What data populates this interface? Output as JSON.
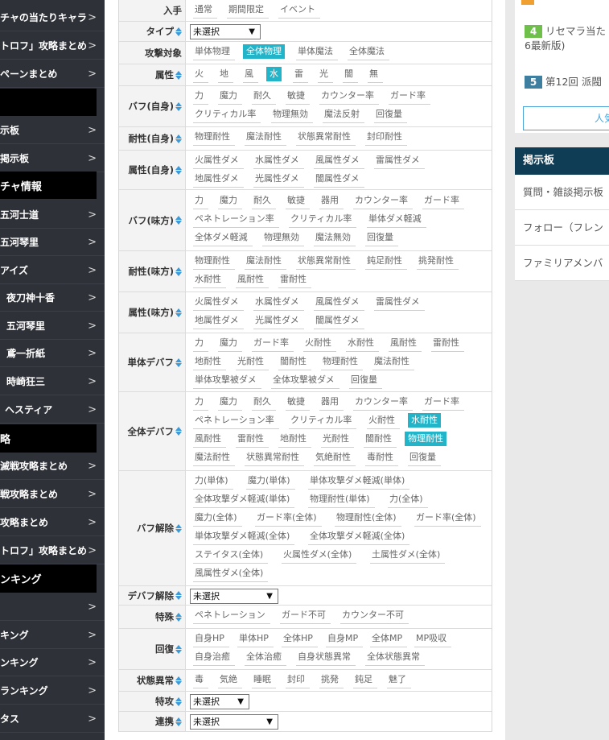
{
  "sidebar": {
    "items": [
      {
        "label": "チャの当たりキャラ",
        "type": "item"
      },
      {
        "label": "トロフ」攻略まとめ",
        "type": "item"
      },
      {
        "label": "ペーンまとめ",
        "type": "item"
      },
      {
        "label": "",
        "type": "head"
      },
      {
        "label": "示板",
        "type": "item"
      },
      {
        "label": "掲示板",
        "type": "item"
      },
      {
        "label": "チャ情報",
        "type": "head"
      },
      {
        "label": "五河士道",
        "type": "item"
      },
      {
        "label": "五河琴里",
        "type": "item"
      },
      {
        "label": "アイズ",
        "type": "item"
      },
      {
        "label": "夜刀神十香",
        "type": "item"
      },
      {
        "label": "五河琴里",
        "type": "item"
      },
      {
        "label": "鳶一折紙",
        "type": "item"
      },
      {
        "label": "時崎狂三",
        "type": "item"
      },
      {
        "label": "ヘスティア",
        "type": "item"
      },
      {
        "label": "略",
        "type": "head"
      },
      {
        "label": "滅戦攻略まとめ",
        "type": "item"
      },
      {
        "label": "戦攻略まとめ",
        "type": "item"
      },
      {
        "label": "攻略まとめ",
        "type": "item"
      },
      {
        "label": "トロフ」攻略まとめ",
        "type": "item"
      },
      {
        "label": "ンキング",
        "type": "head"
      },
      {
        "label": "",
        "type": "item"
      },
      {
        "label": "キング",
        "type": "item"
      },
      {
        "label": "ンキング",
        "type": "item"
      },
      {
        "label": "ランキング",
        "type": "item"
      },
      {
        "label": "タス",
        "type": "item"
      }
    ]
  },
  "filters": [
    {
      "label": "入手",
      "sort": false,
      "options": [
        [
          "通常",
          "期間限定",
          "イベント"
        ]
      ]
    },
    {
      "label": "タイプ",
      "sort": true,
      "select": "未選択"
    },
    {
      "label": "攻撃対象",
      "sort": false,
      "options": [
        [
          "単体物理",
          "全体物理",
          "単体魔法",
          "全体魔法"
        ]
      ],
      "selected": [
        "全体物理"
      ]
    },
    {
      "label": "属性",
      "sort": true,
      "options": [
        [
          "火",
          "地",
          "風",
          "水",
          "雷",
          "光",
          "闇",
          "無"
        ]
      ],
      "selected": [
        "水"
      ]
    },
    {
      "label": "バフ(自身)",
      "sort": true,
      "options": [
        [
          "力",
          "魔力",
          "耐久",
          "敏捷",
          "カウンター率",
          "ガード率"
        ],
        [
          "クリティカル率",
          "物理無効",
          "魔法反射",
          "回復量"
        ]
      ]
    },
    {
      "label": "耐性(自身)",
      "sort": true,
      "options": [
        [
          "物理耐性",
          "魔法耐性",
          "状態異常耐性",
          "封印耐性"
        ]
      ]
    },
    {
      "label": "属性(自身)",
      "sort": true,
      "options": [
        [
          "火属性ダメ",
          "水属性ダメ",
          "風属性ダメ",
          "雷属性ダメ"
        ],
        [
          "地属性ダメ",
          "光属性ダメ",
          "闇属性ダメ"
        ]
      ]
    },
    {
      "label": "バフ(味方)",
      "sort": true,
      "options": [
        [
          "力",
          "魔力",
          "耐久",
          "敏捷",
          "器用",
          "カウンター率",
          "ガード率"
        ],
        [
          "ペネトレーション率",
          "クリティカル率",
          "単体ダメ軽減"
        ],
        [
          "全体ダメ軽減",
          "物理無効",
          "魔法無効",
          "回復量"
        ]
      ]
    },
    {
      "label": "耐性(味方)",
      "sort": true,
      "options": [
        [
          "物理耐性",
          "魔法耐性",
          "状態異常耐性",
          "鈍足耐性",
          "挑発耐性"
        ],
        [
          "水耐性",
          "風耐性",
          "雷耐性"
        ]
      ]
    },
    {
      "label": "属性(味方)",
      "sort": true,
      "options": [
        [
          "火属性ダメ",
          "水属性ダメ",
          "風属性ダメ",
          "雷属性ダメ"
        ],
        [
          "地属性ダメ",
          "光属性ダメ",
          "闇属性ダメ"
        ]
      ]
    },
    {
      "label": "単体デバフ",
      "sort": true,
      "options": [
        [
          "力",
          "魔力",
          "ガード率",
          "火耐性",
          "水耐性",
          "風耐性",
          "雷耐性"
        ],
        [
          "地耐性",
          "光耐性",
          "闇耐性",
          "物理耐性",
          "魔法耐性"
        ],
        [
          "単体攻撃被ダメ",
          "全体攻撃被ダメ",
          "回復量"
        ]
      ]
    },
    {
      "label": "全体デバフ",
      "sort": true,
      "options": [
        [
          "力",
          "魔力",
          "耐久",
          "敏捷",
          "器用",
          "カウンター率",
          "ガード率"
        ],
        [
          "ペネトレーション率",
          "クリティカル率",
          "火耐性",
          "水耐性"
        ],
        [
          "風耐性",
          "雷耐性",
          "地耐性",
          "光耐性",
          "闇耐性",
          "物理耐性"
        ],
        [
          "魔法耐性",
          "状態異常耐性",
          "気絶耐性",
          "毒耐性",
          "回復量"
        ]
      ],
      "selected": [
        "水耐性",
        "物理耐性"
      ]
    },
    {
      "label": "バフ解除",
      "sort": true,
      "options": [
        [
          "力(単体)",
          "魔力(単体)",
          "単体攻撃ダメ軽減(単体)"
        ],
        [
          "全体攻撃ダメ軽減(単体)",
          "物理耐性(単体)",
          "力(全体)"
        ],
        [
          "魔力(全体)",
          "ガード率(全体)",
          "物理耐性(全体)",
          "ガード率(全体)"
        ],
        [
          "単体攻撃ダメ軽減(全体)",
          "全体攻撃ダメ軽減(全体)"
        ],
        [
          "ステイタス(全体)",
          "火属性ダメ(全体)",
          "土属性ダメ(全体)"
        ],
        [
          "風属性ダメ(全体)"
        ]
      ]
    },
    {
      "label": "デバフ解除",
      "sort": true,
      "select": "未選択"
    },
    {
      "label": "特殊",
      "sort": true,
      "options": [
        [
          "ペネトレーション",
          "ガード不可",
          "カウンター不可"
        ]
      ]
    },
    {
      "label": "回復",
      "sort": true,
      "options": [
        [
          "自身HP",
          "単体HP",
          "全体HP",
          "自身MP",
          "全体MP",
          "MP吸収"
        ],
        [
          "自身治癒",
          "全体治癒",
          "自身状態異常",
          "全体状態異常"
        ]
      ]
    },
    {
      "label": "状態異常",
      "sort": true,
      "options": [
        [
          "毒",
          "気絶",
          "睡眠",
          "封印",
          "挑発",
          "鈍足",
          "魅了"
        ]
      ]
    },
    {
      "label": "特攻",
      "sort": true,
      "select": "未選択"
    },
    {
      "label": "連携",
      "sort": true,
      "select": "未選択"
    }
  ],
  "right_top": {
    "item4": {
      "num": "4",
      "text": "リセマラ当た",
      "text2": "6最新版)",
      "color": "#6fbf4b"
    },
    "item5": {
      "num": "5",
      "text": "第12回 派閥",
      "color": "#3e7fa0"
    },
    "button": "人気"
  },
  "bulletin": {
    "title": "掲示板",
    "items": [
      "質問・雑談掲示板",
      "フォロー（フレン",
      "ファミリアメンバ"
    ]
  }
}
